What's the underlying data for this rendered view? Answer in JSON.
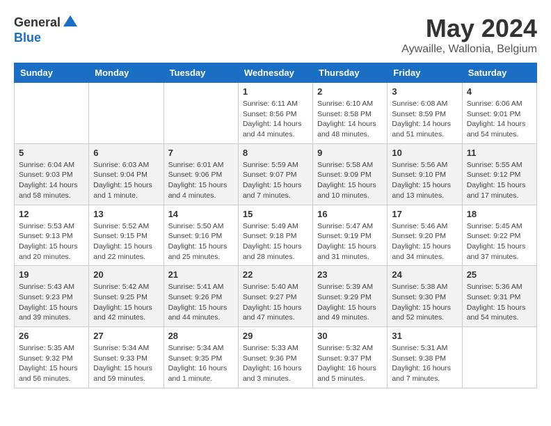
{
  "logo": {
    "general": "General",
    "blue": "Blue"
  },
  "title": {
    "month_year": "May 2024",
    "location": "Aywaille, Wallonia, Belgium"
  },
  "headers": [
    "Sunday",
    "Monday",
    "Tuesday",
    "Wednesday",
    "Thursday",
    "Friday",
    "Saturday"
  ],
  "weeks": [
    {
      "days": [
        {
          "date": "",
          "sunrise": "",
          "sunset": "",
          "daylight": ""
        },
        {
          "date": "",
          "sunrise": "",
          "sunset": "",
          "daylight": ""
        },
        {
          "date": "",
          "sunrise": "",
          "sunset": "",
          "daylight": ""
        },
        {
          "date": "1",
          "sunrise": "Sunrise: 6:11 AM",
          "sunset": "Sunset: 8:56 PM",
          "daylight": "Daylight: 14 hours and 44 minutes."
        },
        {
          "date": "2",
          "sunrise": "Sunrise: 6:10 AM",
          "sunset": "Sunset: 8:58 PM",
          "daylight": "Daylight: 14 hours and 48 minutes."
        },
        {
          "date": "3",
          "sunrise": "Sunrise: 6:08 AM",
          "sunset": "Sunset: 8:59 PM",
          "daylight": "Daylight: 14 hours and 51 minutes."
        },
        {
          "date": "4",
          "sunrise": "Sunrise: 6:06 AM",
          "sunset": "Sunset: 9:01 PM",
          "daylight": "Daylight: 14 hours and 54 minutes."
        }
      ]
    },
    {
      "days": [
        {
          "date": "5",
          "sunrise": "Sunrise: 6:04 AM",
          "sunset": "Sunset: 9:03 PM",
          "daylight": "Daylight: 14 hours and 58 minutes."
        },
        {
          "date": "6",
          "sunrise": "Sunrise: 6:03 AM",
          "sunset": "Sunset: 9:04 PM",
          "daylight": "Daylight: 15 hours and 1 minute."
        },
        {
          "date": "7",
          "sunrise": "Sunrise: 6:01 AM",
          "sunset": "Sunset: 9:06 PM",
          "daylight": "Daylight: 15 hours and 4 minutes."
        },
        {
          "date": "8",
          "sunrise": "Sunrise: 5:59 AM",
          "sunset": "Sunset: 9:07 PM",
          "daylight": "Daylight: 15 hours and 7 minutes."
        },
        {
          "date": "9",
          "sunrise": "Sunrise: 5:58 AM",
          "sunset": "Sunset: 9:09 PM",
          "daylight": "Daylight: 15 hours and 10 minutes."
        },
        {
          "date": "10",
          "sunrise": "Sunrise: 5:56 AM",
          "sunset": "Sunset: 9:10 PM",
          "daylight": "Daylight: 15 hours and 13 minutes."
        },
        {
          "date": "11",
          "sunrise": "Sunrise: 5:55 AM",
          "sunset": "Sunset: 9:12 PM",
          "daylight": "Daylight: 15 hours and 17 minutes."
        }
      ]
    },
    {
      "days": [
        {
          "date": "12",
          "sunrise": "Sunrise: 5:53 AM",
          "sunset": "Sunset: 9:13 PM",
          "daylight": "Daylight: 15 hours and 20 minutes."
        },
        {
          "date": "13",
          "sunrise": "Sunrise: 5:52 AM",
          "sunset": "Sunset: 9:15 PM",
          "daylight": "Daylight: 15 hours and 22 minutes."
        },
        {
          "date": "14",
          "sunrise": "Sunrise: 5:50 AM",
          "sunset": "Sunset: 9:16 PM",
          "daylight": "Daylight: 15 hours and 25 minutes."
        },
        {
          "date": "15",
          "sunrise": "Sunrise: 5:49 AM",
          "sunset": "Sunset: 9:18 PM",
          "daylight": "Daylight: 15 hours and 28 minutes."
        },
        {
          "date": "16",
          "sunrise": "Sunrise: 5:47 AM",
          "sunset": "Sunset: 9:19 PM",
          "daylight": "Daylight: 15 hours and 31 minutes."
        },
        {
          "date": "17",
          "sunrise": "Sunrise: 5:46 AM",
          "sunset": "Sunset: 9:20 PM",
          "daylight": "Daylight: 15 hours and 34 minutes."
        },
        {
          "date": "18",
          "sunrise": "Sunrise: 5:45 AM",
          "sunset": "Sunset: 9:22 PM",
          "daylight": "Daylight: 15 hours and 37 minutes."
        }
      ]
    },
    {
      "days": [
        {
          "date": "19",
          "sunrise": "Sunrise: 5:43 AM",
          "sunset": "Sunset: 9:23 PM",
          "daylight": "Daylight: 15 hours and 39 minutes."
        },
        {
          "date": "20",
          "sunrise": "Sunrise: 5:42 AM",
          "sunset": "Sunset: 9:25 PM",
          "daylight": "Daylight: 15 hours and 42 minutes."
        },
        {
          "date": "21",
          "sunrise": "Sunrise: 5:41 AM",
          "sunset": "Sunset: 9:26 PM",
          "daylight": "Daylight: 15 hours and 44 minutes."
        },
        {
          "date": "22",
          "sunrise": "Sunrise: 5:40 AM",
          "sunset": "Sunset: 9:27 PM",
          "daylight": "Daylight: 15 hours and 47 minutes."
        },
        {
          "date": "23",
          "sunrise": "Sunrise: 5:39 AM",
          "sunset": "Sunset: 9:29 PM",
          "daylight": "Daylight: 15 hours and 49 minutes."
        },
        {
          "date": "24",
          "sunrise": "Sunrise: 5:38 AM",
          "sunset": "Sunset: 9:30 PM",
          "daylight": "Daylight: 15 hours and 52 minutes."
        },
        {
          "date": "25",
          "sunrise": "Sunrise: 5:36 AM",
          "sunset": "Sunset: 9:31 PM",
          "daylight": "Daylight: 15 hours and 54 minutes."
        }
      ]
    },
    {
      "days": [
        {
          "date": "26",
          "sunrise": "Sunrise: 5:35 AM",
          "sunset": "Sunset: 9:32 PM",
          "daylight": "Daylight: 15 hours and 56 minutes."
        },
        {
          "date": "27",
          "sunrise": "Sunrise: 5:34 AM",
          "sunset": "Sunset: 9:33 PM",
          "daylight": "Daylight: 15 hours and 59 minutes."
        },
        {
          "date": "28",
          "sunrise": "Sunrise: 5:34 AM",
          "sunset": "Sunset: 9:35 PM",
          "daylight": "Daylight: 16 hours and 1 minute."
        },
        {
          "date": "29",
          "sunrise": "Sunrise: 5:33 AM",
          "sunset": "Sunset: 9:36 PM",
          "daylight": "Daylight: 16 hours and 3 minutes."
        },
        {
          "date": "30",
          "sunrise": "Sunrise: 5:32 AM",
          "sunset": "Sunset: 9:37 PM",
          "daylight": "Daylight: 16 hours and 5 minutes."
        },
        {
          "date": "31",
          "sunrise": "Sunrise: 5:31 AM",
          "sunset": "Sunset: 9:38 PM",
          "daylight": "Daylight: 16 hours and 7 minutes."
        },
        {
          "date": "",
          "sunrise": "",
          "sunset": "",
          "daylight": ""
        }
      ]
    }
  ]
}
